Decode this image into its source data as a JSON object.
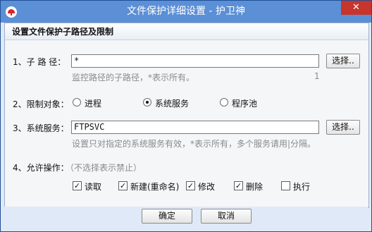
{
  "window": {
    "title": "文件保护详细设置 - 护卫神",
    "close_label": "✕"
  },
  "section": {
    "title": "设置文件保护子路径及限制"
  },
  "subpath": {
    "label": "1、子 路 径：",
    "value": "*",
    "browse": "选择..",
    "hint": "监控路径的子路径，*表示所有。",
    "count": "1"
  },
  "limit": {
    "label": "2、限制对象：",
    "options": [
      {
        "label": "进程",
        "selected": false
      },
      {
        "label": "系统服务",
        "selected": true
      },
      {
        "label": "程序池",
        "selected": false
      }
    ]
  },
  "service": {
    "label": "3、系统服务：",
    "value": "FTPSVC",
    "browse": "选择..",
    "hint": "设置只对指定的系统服务有效，*表示所有，多个服务请用|分隔。"
  },
  "operations": {
    "label": "4、允许操作：",
    "note": "（不选择表示禁止）",
    "items": [
      {
        "label": "读取",
        "checked": true
      },
      {
        "label": "新建(重命名)",
        "checked": true
      },
      {
        "label": "修改",
        "checked": true
      },
      {
        "label": "删除",
        "checked": true
      },
      {
        "label": "执行",
        "checked": false
      }
    ]
  },
  "footer": {
    "ok": "确定",
    "cancel": "取消"
  },
  "colors": {
    "titlebar": "#5b8fd6",
    "close": "#c7352d",
    "frame": "#dfe9f7"
  }
}
